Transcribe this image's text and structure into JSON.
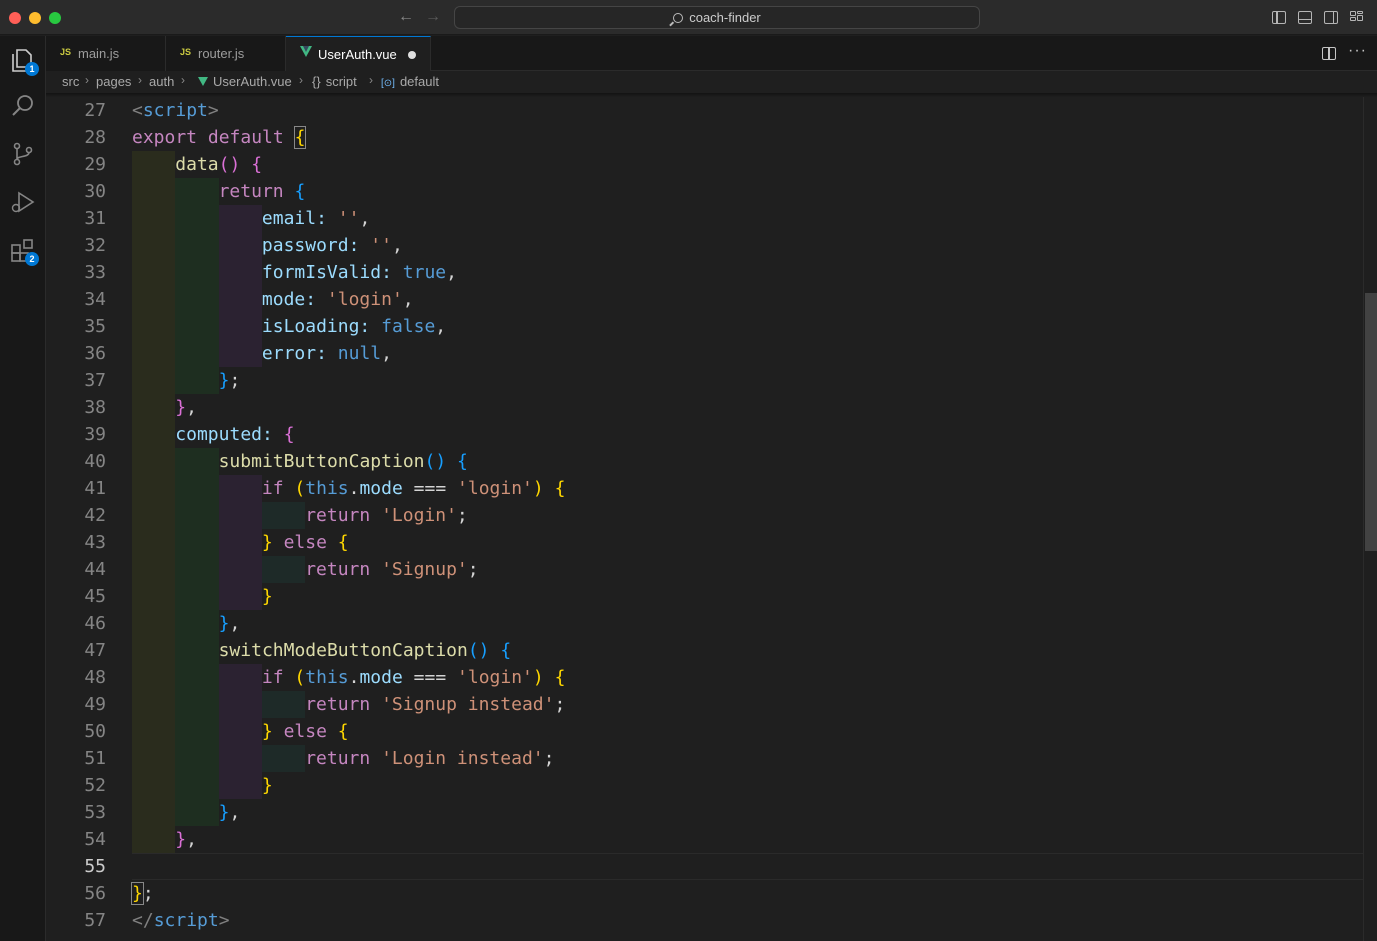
{
  "titlebar": {
    "search_text": "coach-finder"
  },
  "activity": {
    "explorer_badge": "1",
    "extensions_badge": "2"
  },
  "tabs": [
    {
      "label": "main.js",
      "icon": "JS",
      "active": false
    },
    {
      "label": "router.js",
      "icon": "JS",
      "active": false
    },
    {
      "label": "UserAuth.vue",
      "icon": "vue-icon",
      "active": true,
      "dirty": true
    }
  ],
  "breadcrumb": {
    "p1": "src",
    "p2": "pages",
    "p3": "auth",
    "p4": "UserAuth.vue",
    "p5": "script",
    "p6": "default"
  },
  "editor": {
    "line_numbers": [
      "27",
      "28",
      "29",
      "30",
      "31",
      "32",
      "33",
      "34",
      "35",
      "36",
      "37",
      "38",
      "39",
      "40",
      "41",
      "42",
      "43",
      "44",
      "45",
      "46",
      "47",
      "48",
      "49",
      "50",
      "51",
      "52",
      "53",
      "54",
      "55",
      "56",
      "57"
    ],
    "current_line": "55",
    "tokens": {
      "lt": "<",
      "gt": ">",
      "ltslash": "</",
      "script": "script",
      "export": "export",
      "default": "default",
      "ob": "{",
      "cb": "}",
      "op": "(",
      "cp": ")",
      "opcp": "()",
      "data": "data",
      "return": "return",
      "email": "email:",
      "password": "password:",
      "formIsValid": "formIsValid:",
      "mode": "mode:",
      "isLoading": "isLoading:",
      "error": "error:",
      "emptystr": "''",
      "true": "true",
      "false": "false",
      "null": "null",
      "s_login": "'login'",
      "s_Login": "'Login'",
      "s_Signup": "'Signup'",
      "s_SignupInstead": "'Signup instead'",
      "s_LoginInstead": "'Login instead'",
      "comma": ",",
      "semi": ";",
      "cbcomma": "},",
      "cbsemi": "};",
      "computed": "computed:",
      "submitButtonCaption": "submitButtonCaption",
      "switchModeButtonCaption": "switchModeButtonCaption",
      "if": "if",
      "this": "this",
      "dot": ".",
      "modeprop": "mode",
      "eq": "===",
      "else": "else"
    }
  }
}
